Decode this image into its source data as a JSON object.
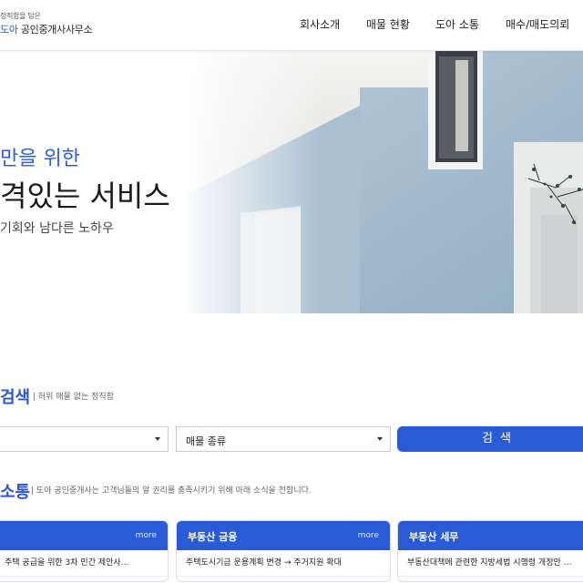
{
  "header": {
    "logo_tagline": "정직함을 담은",
    "logo_brand": "도아",
    "logo_name": "공인중개사사무소",
    "nav": [
      "회사소개",
      "매물 현황",
      "도아 소통",
      "매수/매도의뢰"
    ]
  },
  "hero": {
    "line1": "만을 위한",
    "line2": "격있는 서비스",
    "line3": "기회와 남다른 노하우"
  },
  "search": {
    "title": "검색",
    "subtitle": "| 허위 매물 없는 정직함",
    "select1_value": "",
    "select2_value": "매물 종류",
    "button_label": "검 색"
  },
  "news": {
    "title": "소통",
    "subtitle": "| 도아 공인중개사는 고객님들의 알 권리를 충족시키기 위해 아래 소식을 전합니다.",
    "cards": [
      {
        "title": "",
        "more": "more",
        "item": "주택 공급을 위한 3차 민간 제안사…"
      },
      {
        "title": "부동산 금융",
        "more": "more",
        "item": "주택도시기금 운용계획 변경 → 주거지원 확대"
      },
      {
        "title": "부동산 세무",
        "more": "more",
        "item": "부동산대책에 관련한 지방세법 시행령 개정안 …"
      }
    ]
  },
  "colors": {
    "accent": "#2a5bd7",
    "hero_blue": "#2d5fd9",
    "wall": "#9fb7c9"
  }
}
